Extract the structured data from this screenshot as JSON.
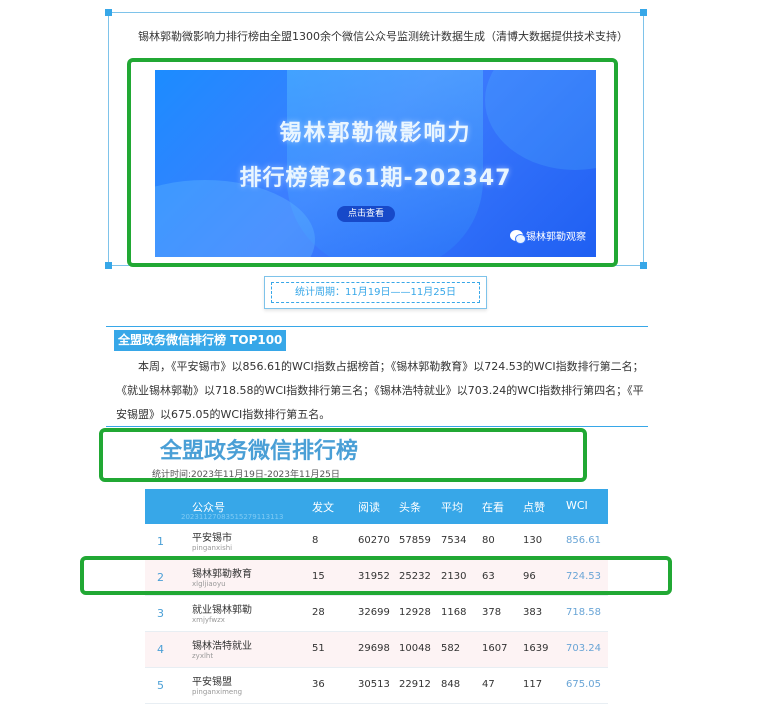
{
  "intro": {
    "text": "锡林郭勒微影响力排行榜由全盟1300余个微信公众号监测统计数据生成（清博大数据提供技术支持）"
  },
  "banner": {
    "title_line1": "锡林郭勒微影响力",
    "title_line2": "排行榜第261期-202347",
    "button_label": "点击查看",
    "brand": "锡林郭勒观察"
  },
  "period": {
    "label": "统计周期：11月19日——11月25日"
  },
  "section": {
    "title": "全盟政务微信排行榜 TOP100",
    "text": "本周，《平安锡市》以856.61的WCI指数占据榜首；《锡林郭勒教育》以724.53的WCI指数排行第二名；《就业锡林郭勒》以718.58的WCI指数排行第三名；《锡林浩特就业》以703.24的WCI指数排行第四名；《平安锡盟》以675.05的WCI指数排行第五名。"
  },
  "ranking": {
    "title": "全盟政务微信排行榜",
    "subtitle": "统计时间:2023年11月19日-2023年11月25日",
    "header_code": "20231127083515279113113",
    "columns": [
      "公众号",
      "发文",
      "阅读",
      "头条",
      "平均",
      "在看",
      "点赞",
      "WCI"
    ],
    "rows": [
      {
        "rank": "1",
        "name": "平安锡市",
        "pinyin": "pinganxishi",
        "posts": "8",
        "reads": "60270",
        "headline": "57859",
        "avg": "7534",
        "watching": "80",
        "likes": "130",
        "wci": "856.61"
      },
      {
        "rank": "2",
        "name": "锡林郭勒教育",
        "pinyin": "xlgljiaoyu",
        "posts": "15",
        "reads": "31952",
        "headline": "25232",
        "avg": "2130",
        "watching": "63",
        "likes": "96",
        "wci": "724.53"
      },
      {
        "rank": "3",
        "name": "就业锡林郭勒",
        "pinyin": "xmjyfwzx",
        "posts": "28",
        "reads": "32699",
        "headline": "12928",
        "avg": "1168",
        "watching": "378",
        "likes": "383",
        "wci": "718.58"
      },
      {
        "rank": "4",
        "name": "锡林浩特就业",
        "pinyin": "zyxlht",
        "posts": "51",
        "reads": "29698",
        "headline": "10048",
        "avg": "582",
        "watching": "1607",
        "likes": "1639",
        "wci": "703.24"
      },
      {
        "rank": "5",
        "name": "平安锡盟",
        "pinyin": "pinganximeng",
        "posts": "36",
        "reads": "30513",
        "headline": "22912",
        "avg": "848",
        "watching": "47",
        "likes": "117",
        "wci": "675.05"
      }
    ]
  },
  "colors": {
    "accent_blue": "#37a7e8",
    "highlight_green": "#21a834"
  }
}
